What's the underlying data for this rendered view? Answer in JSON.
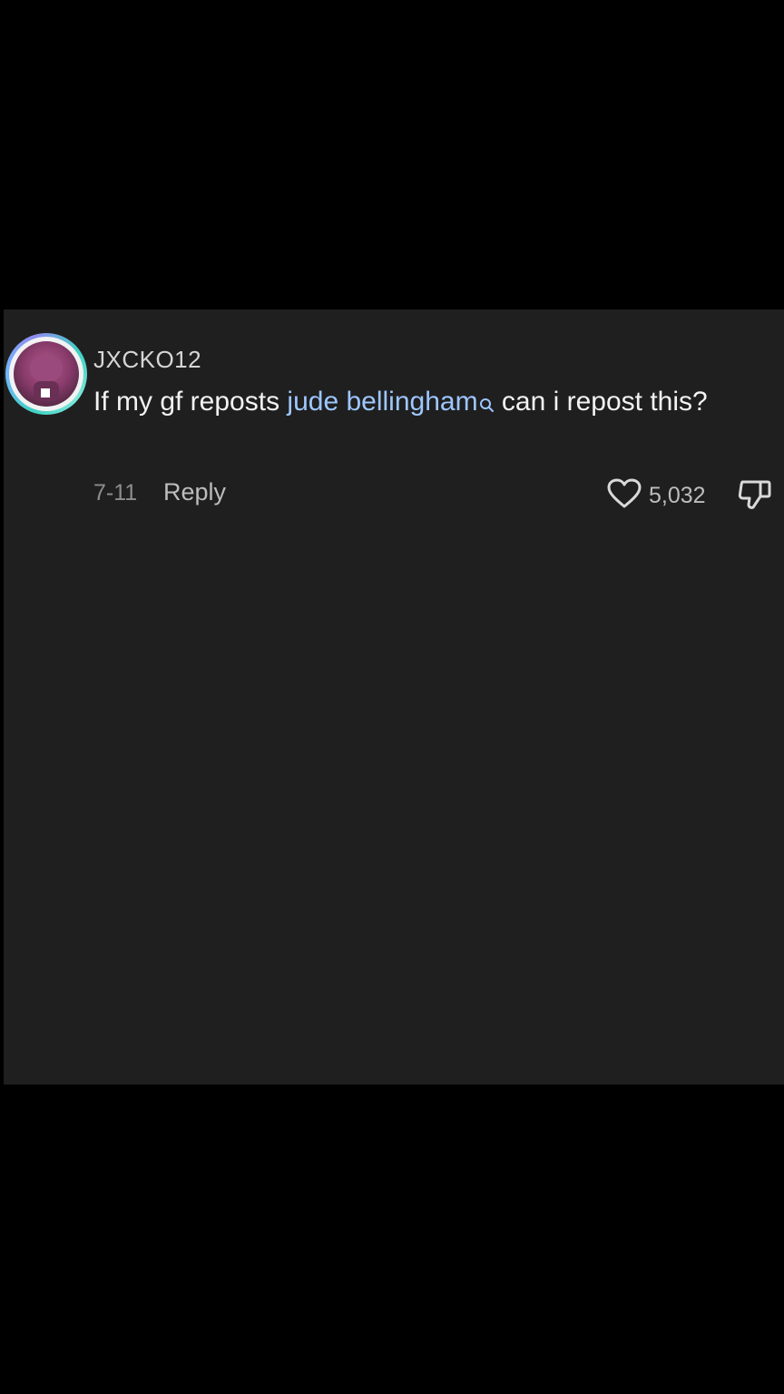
{
  "comment": {
    "username": "JXCKO12",
    "text_before": "If my gf reposts ",
    "mention": "jude bellingham",
    "text_after": " can i repost this?",
    "date": "7-11",
    "reply_label": "Reply",
    "like_count": "5,032"
  },
  "colors": {
    "background": "#000000",
    "panel": "#1f1f1f",
    "mention": "#9ec6ff",
    "avatar_ring": "#3fd1c4"
  },
  "icons": {
    "like": "heart-icon",
    "dislike": "thumbs-down-icon",
    "mention_search": "search-icon"
  }
}
